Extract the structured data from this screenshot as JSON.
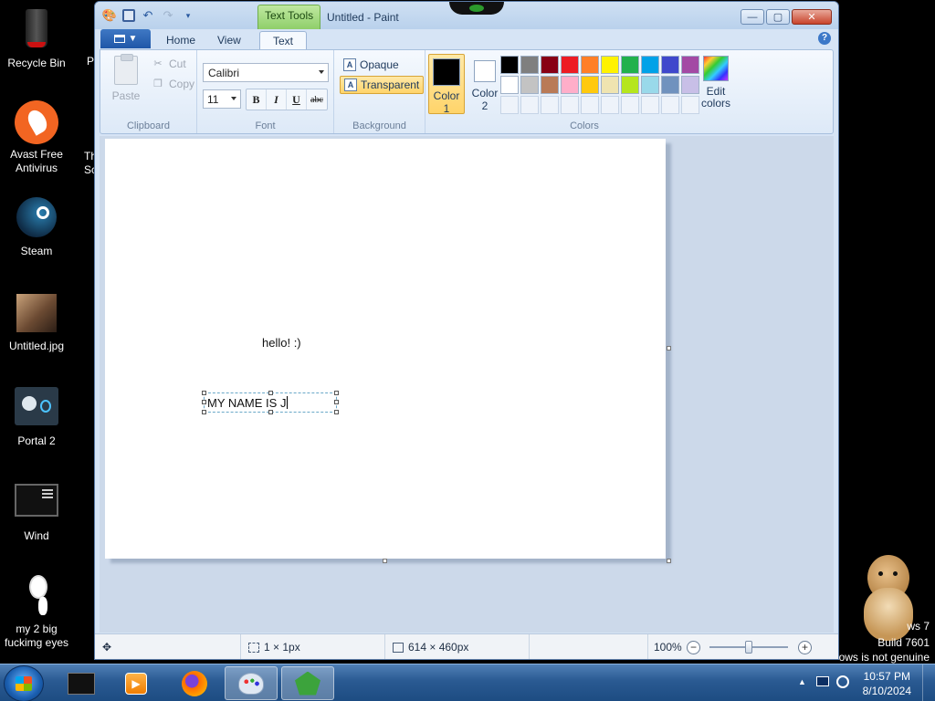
{
  "desktop": {
    "icons": [
      {
        "label": "Recycle Bin"
      },
      {
        "label": "Avast Free Antivirus"
      },
      {
        "label": "Steam"
      },
      {
        "label": "Untitled.jpg"
      },
      {
        "label": "Portal 2"
      },
      {
        "label": "Wind"
      },
      {
        "label": "my 2 big fuckimg eyes"
      }
    ],
    "partial_labels": [
      "P",
      "Th",
      "Sc"
    ],
    "watermark": {
      "line1": "ws 7",
      "line2": "Build 7601",
      "line3": "ows is not genuine"
    }
  },
  "window": {
    "title": "Untitled - Paint",
    "context_tab": "Text Tools",
    "buttons": {
      "minimize": "—",
      "maximize": "▢",
      "close": "✕"
    },
    "help": "?"
  },
  "tabs": [
    {
      "label": "Home"
    },
    {
      "label": "View"
    },
    {
      "label": "Text"
    }
  ],
  "ribbon": {
    "clipboard": {
      "paste": "Paste",
      "cut": "Cut",
      "copy": "Copy",
      "group": "Clipboard"
    },
    "font": {
      "family": "Calibri",
      "size": "11",
      "bold": "B",
      "italic": "I",
      "underline": "U",
      "strike": "abc",
      "group": "Font"
    },
    "background": {
      "opaque": "Opaque",
      "transparent": "Transparent",
      "group": "Background"
    },
    "colors": {
      "color1": {
        "label1": "Color",
        "label2": "1",
        "value": "#000000"
      },
      "color2": {
        "label1": "Color",
        "label2": "2",
        "value": "#ffffff"
      },
      "palette_row1": [
        "#000000",
        "#7f7f7f",
        "#880015",
        "#ed1c24",
        "#ff7f27",
        "#fff200",
        "#22b14c",
        "#00a2e8",
        "#3f48cc",
        "#a349a4"
      ],
      "palette_row2": [
        "#ffffff",
        "#c3c3c3",
        "#b97a57",
        "#ffaec9",
        "#ffc90e",
        "#efe4b0",
        "#b5e61d",
        "#99d9ea",
        "#7092be",
        "#c8bfe7"
      ],
      "edit1": "Edit",
      "edit2": "colors",
      "group": "Colors"
    }
  },
  "canvas": {
    "text1": "hello! :)",
    "typing": "MY NAME IS J"
  },
  "status": {
    "selection": "1 × 1px",
    "size": "614 × 460px",
    "zoom": "100%",
    "zoom_level": 0.5
  },
  "taskbar": {
    "time": "10:57 PM",
    "date": "8/10/2024"
  }
}
